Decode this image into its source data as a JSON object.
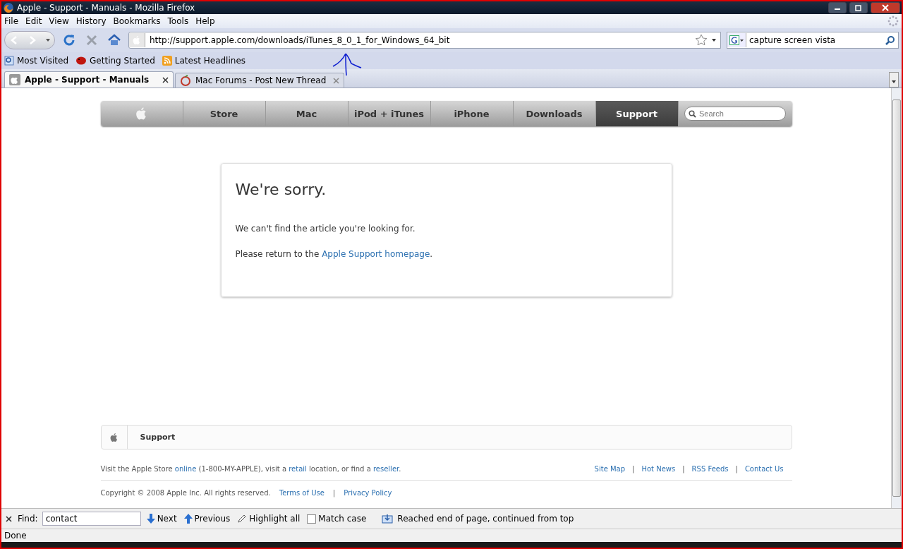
{
  "window": {
    "title": "Apple - Support - Manuals - Mozilla Firefox"
  },
  "menu": [
    "File",
    "Edit",
    "View",
    "History",
    "Bookmarks",
    "Tools",
    "Help"
  ],
  "address": {
    "value": "http://support.apple.com/downloads/iTunes_8_0_1_for_Windows_64_bit"
  },
  "web_search": {
    "value": "capture screen vista"
  },
  "bookmarks": [
    {
      "label": "Most Visited",
      "kind": "search"
    },
    {
      "label": "Getting Started",
      "kind": "bug"
    },
    {
      "label": "Latest Headlines",
      "kind": "rss"
    }
  ],
  "tabs": [
    {
      "label": "Apple - Support - Manuals",
      "selected": true,
      "kind": "apple"
    },
    {
      "label": "Mac Forums - Post New Thread",
      "selected": false,
      "kind": "forum"
    }
  ],
  "site_nav": {
    "items": [
      {
        "label": "Store",
        "selected": false
      },
      {
        "label": "Mac",
        "selected": false
      },
      {
        "label": "iPod + iTunes",
        "selected": false
      },
      {
        "label": "iPhone",
        "selected": false
      },
      {
        "label": "Downloads",
        "selected": false
      },
      {
        "label": "Support",
        "selected": true
      }
    ],
    "search_placeholder": "Search"
  },
  "message": {
    "heading": "We're sorry.",
    "lines": [
      [
        {
          "kind": "text",
          "text": "We can't find the article you're looking for."
        }
      ],
      [
        {
          "kind": "text",
          "text": "Please return to the "
        },
        {
          "kind": "link",
          "text": "Apple Support homepage"
        },
        {
          "kind": "text",
          "text": "."
        }
      ]
    ]
  },
  "breadcrumb": "Support",
  "footer": {
    "store_line": [
      {
        "kind": "text",
        "text": "Visit the Apple Store "
      },
      {
        "kind": "link",
        "text": "online"
      },
      {
        "kind": "text",
        "text": " (1-800-MY-APPLE), visit a "
      },
      {
        "kind": "link",
        "text": "retail"
      },
      {
        "kind": "text",
        "text": " location, or find a "
      },
      {
        "kind": "link",
        "text": "reseller"
      },
      {
        "kind": "text",
        "text": "."
      }
    ],
    "links": [
      {
        "kind": "link",
        "text": "Site Map"
      },
      {
        "kind": "separator",
        "text": "|"
      },
      {
        "kind": "link",
        "text": "Hot News"
      },
      {
        "kind": "separator",
        "text": "|"
      },
      {
        "kind": "link",
        "text": "RSS Feeds"
      },
      {
        "kind": "separator",
        "text": "|"
      },
      {
        "kind": "link",
        "text": "Contact Us"
      }
    ],
    "copyright": "Copyright © 2008 Apple Inc. All rights reserved.",
    "legal_links": [
      {
        "kind": "link",
        "text": "Terms of Use"
      },
      {
        "kind": "separator",
        "text": "|"
      },
      {
        "kind": "link",
        "text": "Privacy Policy"
      }
    ]
  },
  "find_bar": {
    "label": "Find:",
    "value": "contact",
    "next": "Next",
    "previous": "Previous",
    "highlight": "Highlight all",
    "match_case": {
      "label": "Match case",
      "checked": false
    },
    "status": "Reached end of page, continued from top"
  },
  "status_bar": "Done"
}
